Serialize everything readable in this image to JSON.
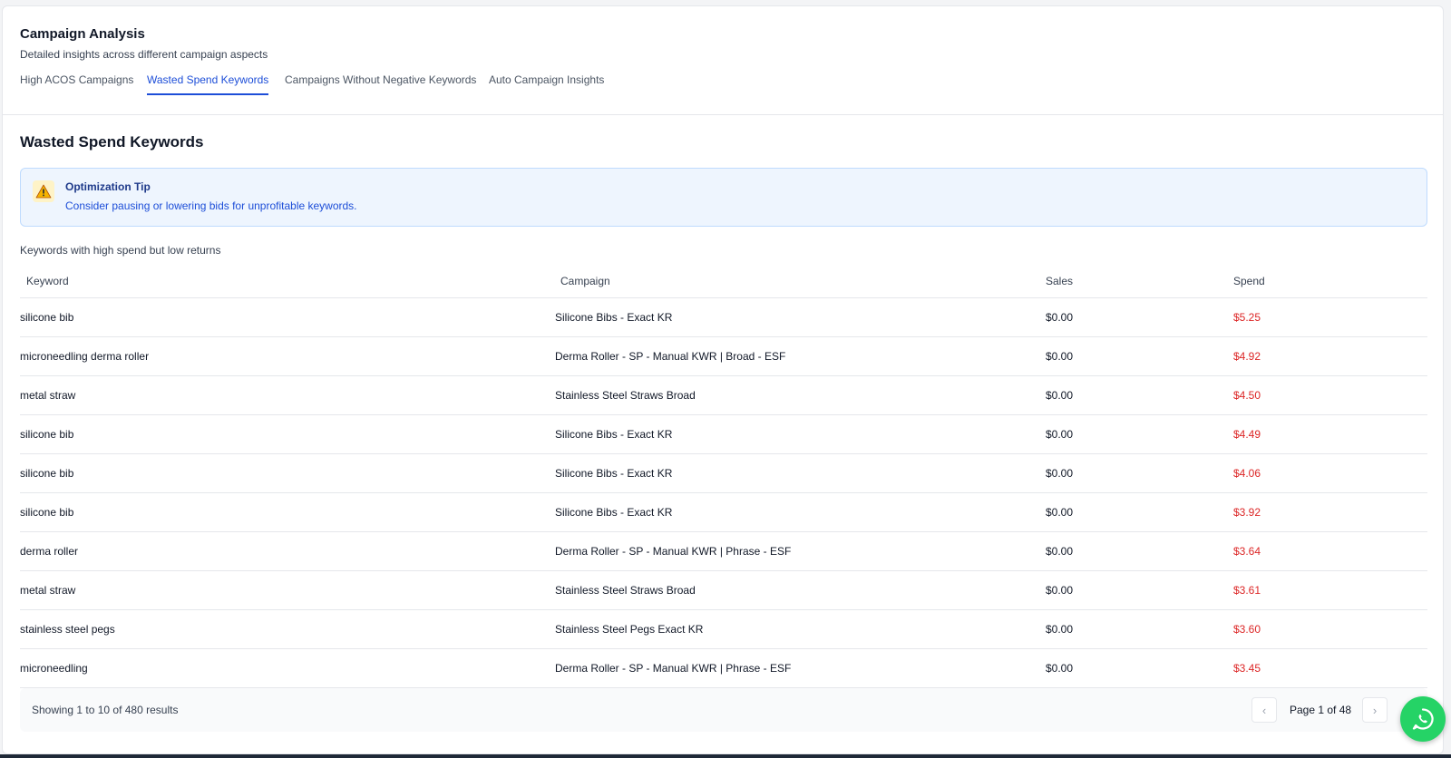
{
  "header": {
    "title": "Campaign Analysis",
    "subtitle": "Detailed insights across different campaign aspects"
  },
  "tabs": [
    {
      "label": "High ACOS Campaigns",
      "active": false
    },
    {
      "label": "Wasted Spend Keywords",
      "active": true
    },
    {
      "label": "Campaigns Without Negative Keywords",
      "active": false
    },
    {
      "label": "Auto Campaign Insights",
      "active": false
    }
  ],
  "section": {
    "title": "Wasted Spend Keywords",
    "tip": {
      "icon": "warning-icon",
      "title": "Optimization Tip",
      "text": "Consider pausing or lowering bids for unprofitable keywords."
    },
    "caption": "Keywords with high spend but low returns"
  },
  "table": {
    "columns": [
      "Keyword",
      "Campaign",
      "Sales",
      "Spend"
    ],
    "rows": [
      {
        "keyword": "silicone bib",
        "campaign": "Silicone Bibs - Exact KR",
        "sales": "$0.00",
        "spend": "$5.25"
      },
      {
        "keyword": "microneedling derma roller",
        "campaign": "Derma Roller - SP - Manual KWR | Broad - ESF",
        "sales": "$0.00",
        "spend": "$4.92"
      },
      {
        "keyword": "metal straw",
        "campaign": "Stainless Steel Straws Broad",
        "sales": "$0.00",
        "spend": "$4.50"
      },
      {
        "keyword": "silicone bib",
        "campaign": "Silicone Bibs - Exact KR",
        "sales": "$0.00",
        "spend": "$4.49"
      },
      {
        "keyword": "silicone bib",
        "campaign": "Silicone Bibs - Exact KR",
        "sales": "$0.00",
        "spend": "$4.06"
      },
      {
        "keyword": "silicone bib",
        "campaign": "Silicone Bibs - Exact KR",
        "sales": "$0.00",
        "spend": "$3.92"
      },
      {
        "keyword": "derma roller",
        "campaign": "Derma Roller - SP - Manual KWR | Phrase - ESF",
        "sales": "$0.00",
        "spend": "$3.64"
      },
      {
        "keyword": "metal straw",
        "campaign": "Stainless Steel Straws Broad",
        "sales": "$0.00",
        "spend": "$3.61"
      },
      {
        "keyword": "stainless steel pegs",
        "campaign": "Stainless Steel Pegs Exact KR",
        "sales": "$0.00",
        "spend": "$3.60"
      },
      {
        "keyword": "microneedling",
        "campaign": "Derma Roller - SP - Manual KWR | Phrase - ESF",
        "sales": "$0.00",
        "spend": "$3.45"
      }
    ]
  },
  "pagination": {
    "showing": "Showing 1 to 10 of 480 results",
    "page_info": "Page 1 of 48",
    "prev_icon": "chevron-left-icon",
    "next_icon": "chevron-right-icon"
  },
  "whatsapp": {
    "icon": "whatsapp-icon",
    "color": "#25d366"
  },
  "colors": {
    "accent": "#1d4ed8",
    "spend": "#dc2626",
    "tip_bg": "#eef5fe"
  }
}
